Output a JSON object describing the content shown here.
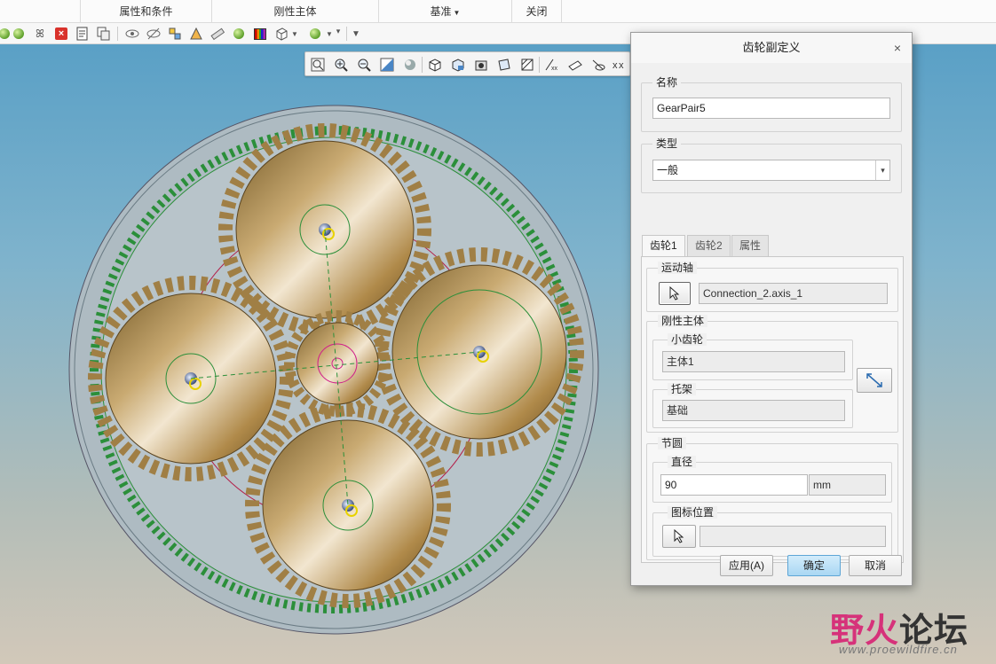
{
  "ribbon_groups": [
    {
      "label": "属性和条件"
    },
    {
      "label": "刚性主体"
    },
    {
      "label": "基准"
    },
    {
      "label": "关闭"
    }
  ],
  "toolbar": {
    "icons": [
      "sphere-icon",
      "delete-icon",
      "cancel-red-icon",
      "document-icon",
      "copy-icon",
      "eye-icon",
      "hide-icon",
      "layers-icon",
      "model-icon",
      "measure-icon",
      "sphere-icon",
      "appearance-color-icon",
      "cube-icon",
      "chevron-down-icon",
      "sphere-icon",
      "chevron-down-icon",
      "overflow-icon"
    ]
  },
  "view_toolbar": {
    "icons": [
      "refit-icon",
      "zoom-in-icon",
      "zoom-out-icon",
      "repaint-icon",
      "shading-icon",
      "standard-orientation-icon",
      "saved-views-icon",
      "view-manager-icon",
      "perspective-icon",
      "section-icon",
      "datum-display-icon",
      "annotation-display-icon",
      "spin-center-icon",
      "display-style-icon"
    ]
  },
  "watermark": {
    "logo_part1": "野火",
    "logo_part2": "论坛",
    "url": "www.proewildfire.cn"
  },
  "dialog": {
    "title": "齿轮副定义",
    "close_glyph": "×",
    "name_section": {
      "legend": "名称",
      "value": "GearPair5"
    },
    "type_section": {
      "legend": "类型",
      "value": "一般",
      "arrow": "▾"
    },
    "tabs": [
      {
        "label": "齿轮1",
        "active": true
      },
      {
        "label": "齿轮2",
        "active": false
      },
      {
        "label": "属性",
        "active": false
      }
    ],
    "motion_axis": {
      "legend": "运动轴",
      "value": "Connection_2.axis_1"
    },
    "rigid_body": {
      "legend": "刚性主体",
      "pinion_legend": "小齿轮",
      "pinion_value": "主体1",
      "carrier_legend": "托架",
      "carrier_value": "基础"
    },
    "pitch_circle": {
      "legend": "节圆",
      "diameter_legend": "直径",
      "diameter_value": "90",
      "unit": "mm",
      "icon_position_legend": "图标位置",
      "icon_position_value": ""
    },
    "buttons": {
      "apply": "应用(A)",
      "ok": "确定",
      "cancel": "取消"
    }
  }
}
